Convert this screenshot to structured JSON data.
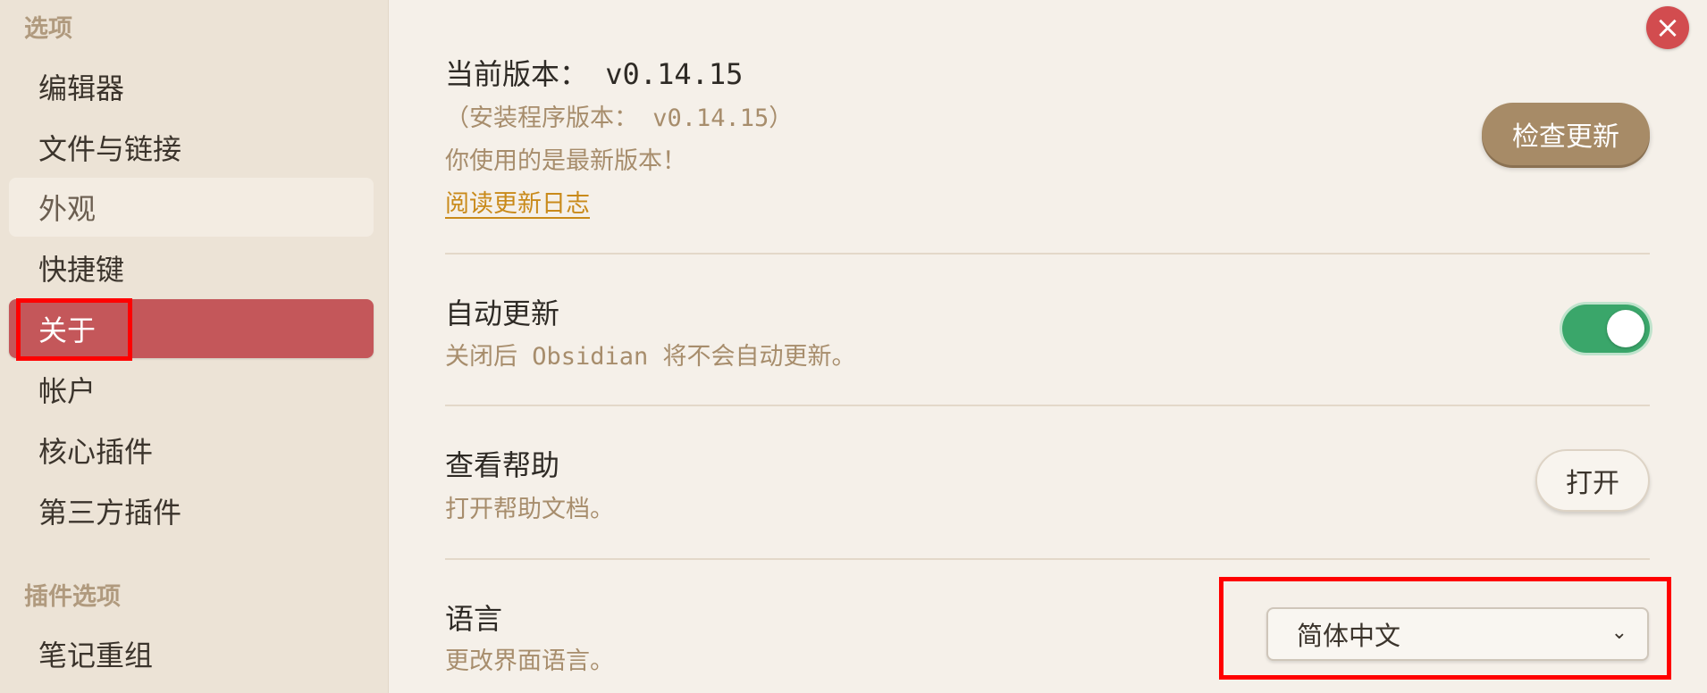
{
  "sidebar": {
    "options_heading": "选项",
    "items": [
      {
        "label": "编辑器"
      },
      {
        "label": "文件与链接"
      },
      {
        "label": "外观"
      },
      {
        "label": "快捷键"
      },
      {
        "label": "关于"
      },
      {
        "label": "帐户"
      },
      {
        "label": "核心插件"
      },
      {
        "label": "第三方插件"
      }
    ],
    "plugin_heading": "插件选项",
    "plugin_items": [
      {
        "label": "笔记重组"
      }
    ]
  },
  "about": {
    "version_label": "当前版本： v0.14.15",
    "installer_version": "（安装程序版本： v0.14.15）",
    "latest_msg": "你使用的是最新版本！",
    "changelog_link": "阅读更新日志",
    "check_update_button": "检查更新"
  },
  "auto_update": {
    "title": "自动更新",
    "desc": "关闭后 Obsidian 将不会自动更新。",
    "enabled": true
  },
  "help": {
    "title": "查看帮助",
    "desc": "打开帮助文档。",
    "button": "打开"
  },
  "language": {
    "title": "语言",
    "desc": "更改界面语言。",
    "selected": "简体中文"
  },
  "colors": {
    "accent": "#c4575a",
    "toggle_on": "#3aa66a",
    "check_button": "#a78b67",
    "link": "#c98a1a",
    "highlight_box": "#ff0000"
  }
}
